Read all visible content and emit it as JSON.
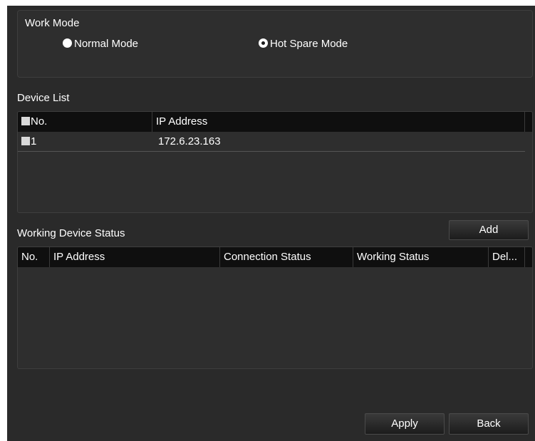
{
  "work_mode": {
    "title": "Work Mode",
    "options": [
      {
        "label": "Normal Mode",
        "selected": false
      },
      {
        "label": "Hot Spare Mode",
        "selected": true
      }
    ]
  },
  "device_list": {
    "title": "Device List",
    "columns": [
      "No.",
      "IP Address"
    ],
    "rows": [
      {
        "no": "1",
        "ip": "172.6.23.163"
      }
    ]
  },
  "working_status": {
    "title": "Working Device Status",
    "add_label": "Add",
    "columns": [
      "No.",
      "IP Address",
      "Connection Status",
      "Working Status",
      "Del..."
    ],
    "rows": []
  },
  "footer": {
    "apply_label": "Apply",
    "back_label": "Back"
  }
}
